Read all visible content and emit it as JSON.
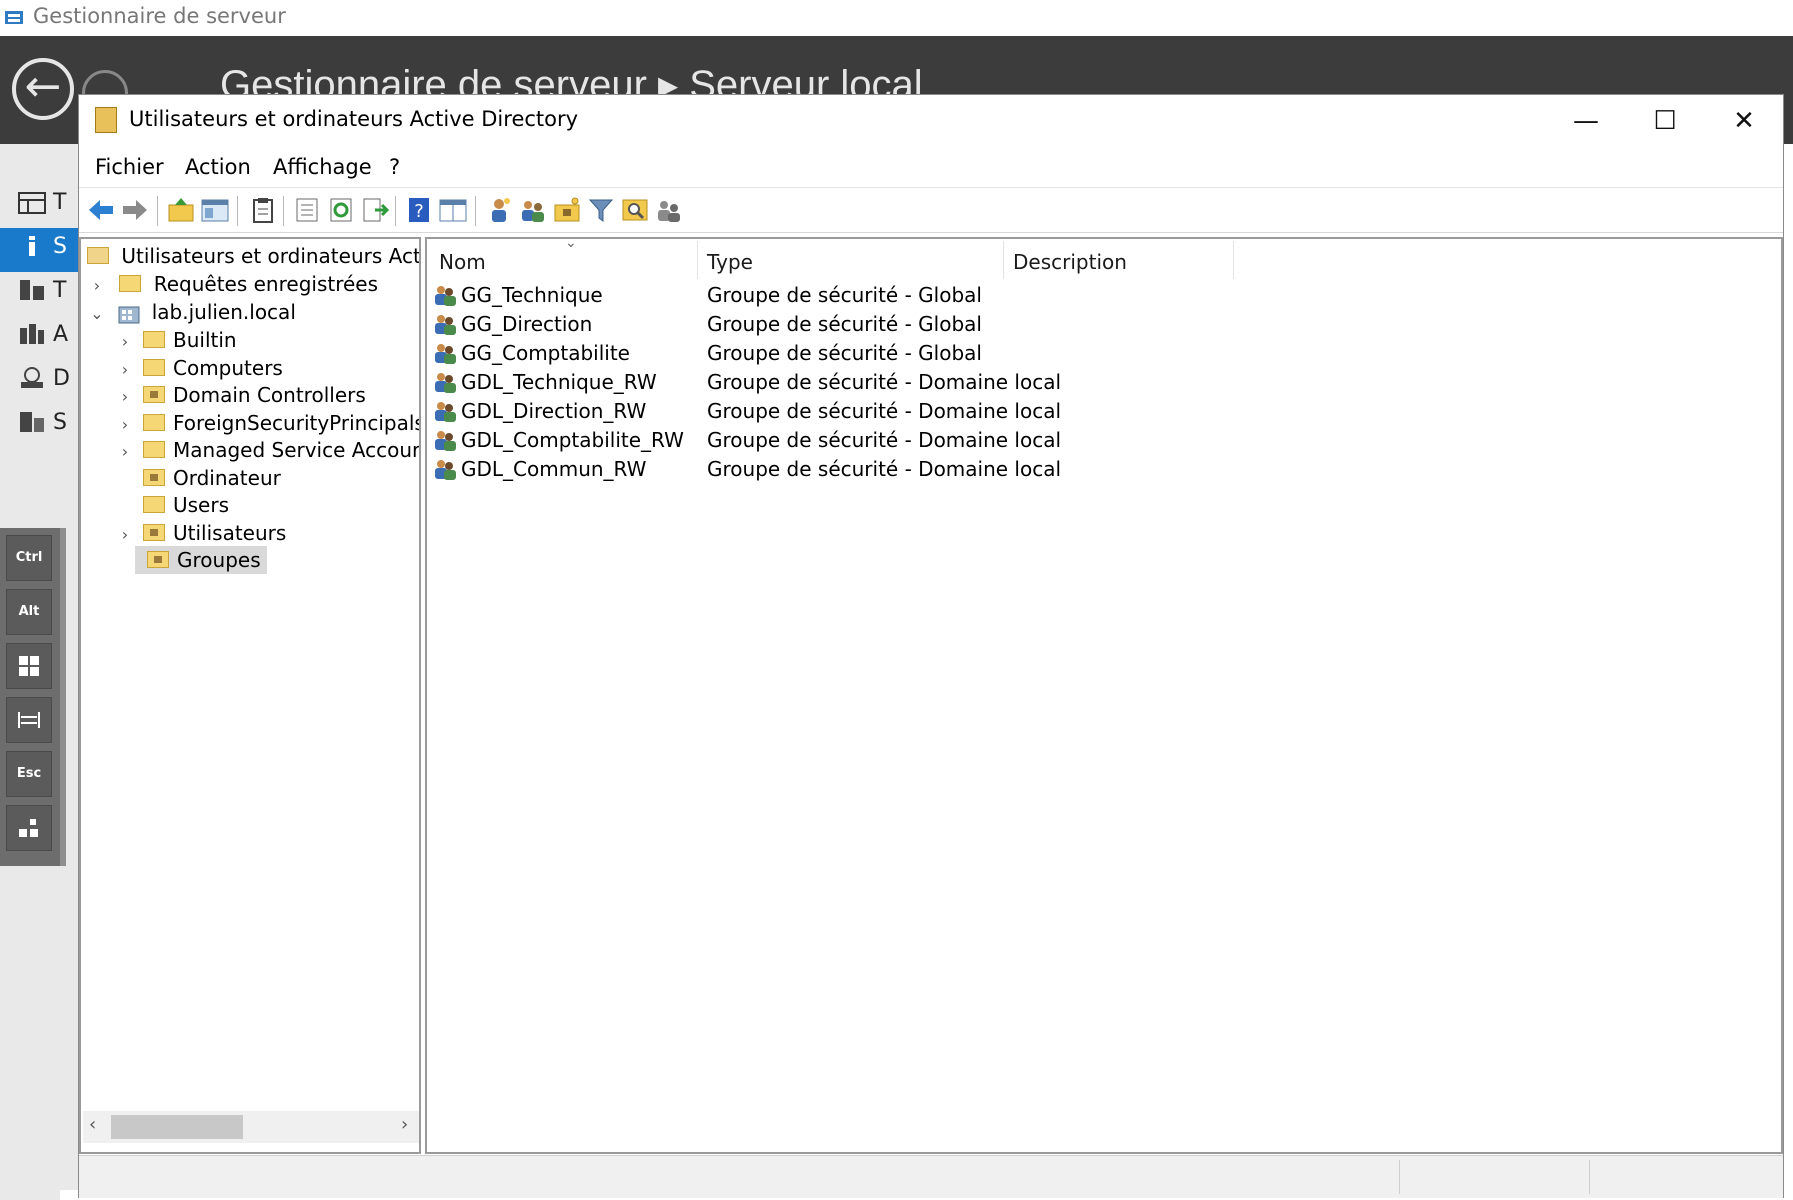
{
  "server_manager": {
    "title": "Gestionnaire de serveur",
    "breadcrumb": "Gestionnaire de serveur  ▸  Serveur local",
    "nav_letters": [
      "T",
      "S",
      "T",
      "A",
      "D",
      "S"
    ],
    "keys": [
      "Ctrl",
      "Alt",
      "win-key",
      "tab-key",
      "Esc",
      "more-keys"
    ]
  },
  "window": {
    "title": "Utilisateurs et ordinateurs Active Directory",
    "minimize": "—",
    "maximize": "☐",
    "close": "✕"
  },
  "menu": [
    "Fichier",
    "Action",
    "Affichage",
    "?"
  ],
  "tree": {
    "root": "Utilisateurs et ordinateurs Active",
    "saved_queries": "Requêtes enregistrées",
    "domain": "lab.julien.local",
    "children": [
      {
        "label": "Builtin",
        "expandable": true,
        "ou": false
      },
      {
        "label": "Computers",
        "expandable": true,
        "ou": false
      },
      {
        "label": "Domain Controllers",
        "expandable": true,
        "ou": true
      },
      {
        "label": "ForeignSecurityPrincipals",
        "expandable": true,
        "ou": false
      },
      {
        "label": "Managed Service Accour",
        "expandable": true,
        "ou": false
      },
      {
        "label": "Ordinateur",
        "expandable": false,
        "ou": true
      },
      {
        "label": "Users",
        "expandable": false,
        "ou": false
      },
      {
        "label": "Utilisateurs",
        "expandable": true,
        "ou": true
      },
      {
        "label": "Groupes",
        "expandable": false,
        "ou": true,
        "selected": true
      }
    ]
  },
  "list": {
    "columns": [
      "Nom",
      "Type",
      "Description"
    ],
    "rows": [
      {
        "name": "GG_Technique",
        "type": "Groupe de sécurité - Global",
        "description": ""
      },
      {
        "name": "GG_Direction",
        "type": "Groupe de sécurité - Global",
        "description": ""
      },
      {
        "name": "GG_Comptabilite",
        "type": "Groupe de sécurité - Global",
        "description": ""
      },
      {
        "name": "GDL_Technique_RW",
        "type": "Groupe de sécurité - Domaine local",
        "description": ""
      },
      {
        "name": "GDL_Direction_RW",
        "type": "Groupe de sécurité - Domaine local",
        "description": ""
      },
      {
        "name": "GDL_Comptabilite_RW",
        "type": "Groupe de sécurité - Domaine local",
        "description": ""
      },
      {
        "name": "GDL_Commun_RW",
        "type": "Groupe de sécurité - Domaine local",
        "description": ""
      }
    ]
  },
  "toolbar_icons": [
    "back-arrow-icon",
    "forward-arrow-icon",
    "up-folder-icon",
    "show-hide-tree-icon",
    "clipboard-icon",
    "properties-icon",
    "refresh-icon",
    "export-list-icon",
    "help-icon",
    "console-view-icon",
    "new-user-icon",
    "new-group-icon",
    "new-ou-icon",
    "filter-icon",
    "find-icon",
    "add-to-group-icon"
  ],
  "colors": {
    "selection": "#1979ca",
    "sm_header": "#3c3c3c"
  }
}
